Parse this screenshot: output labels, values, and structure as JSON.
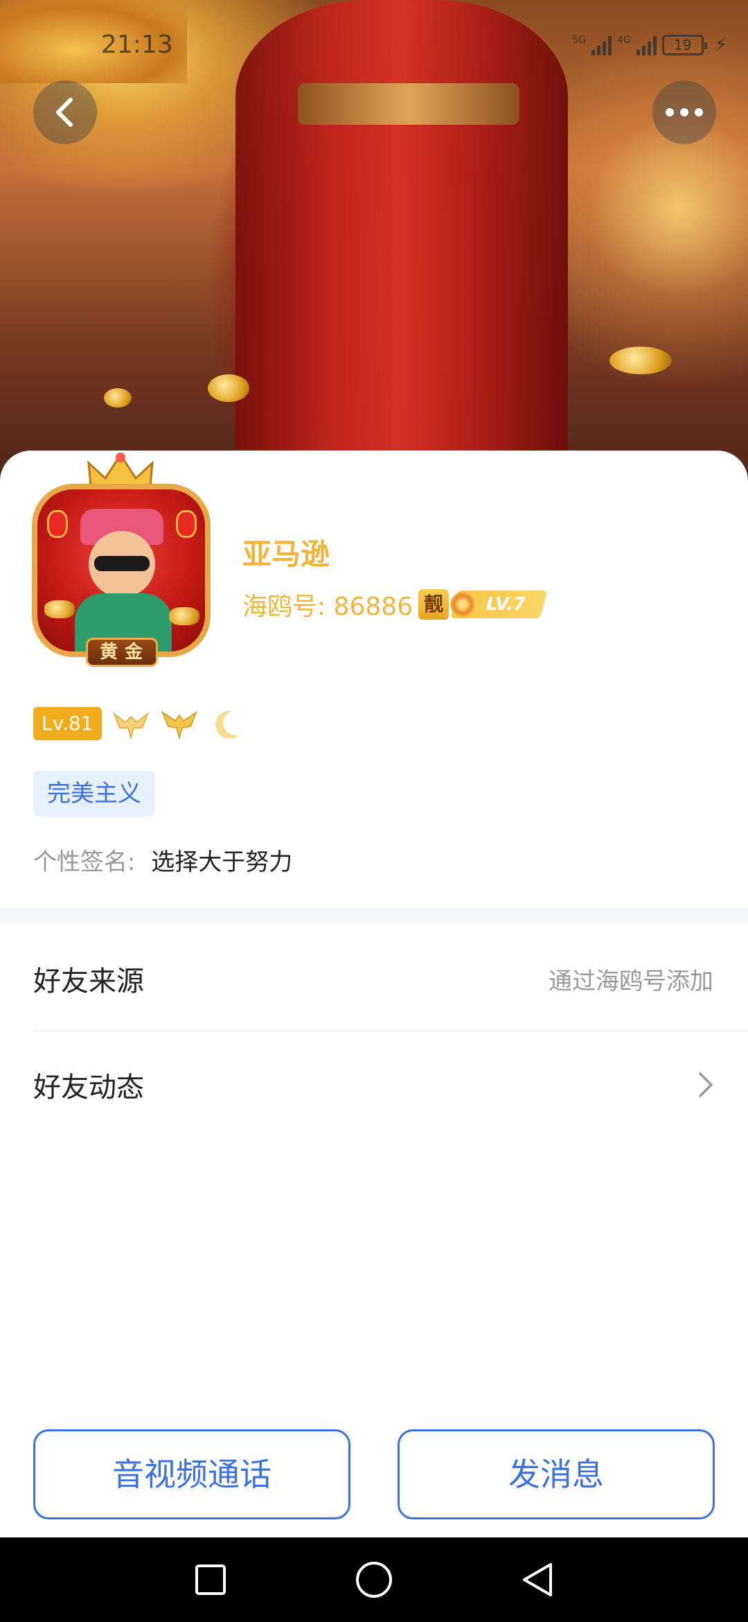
{
  "status_bar": {
    "time": "21:13",
    "net_1": "5G",
    "net_2": "4G",
    "battery": "19"
  },
  "profile": {
    "name": "亚马逊",
    "id_label": "海鸥号: 86886",
    "pretty_tag": "靓",
    "vip_level": "LV.7",
    "avatar_badge": "黄金",
    "user_level": "Lv.81",
    "tag": "完美主义",
    "signature_label": "个性签名:",
    "signature_value": "选择大于努力"
  },
  "rows": {
    "friend_source_title": "好友来源",
    "friend_source_value": "通过海鸥号添加",
    "friend_moments_title": "好友动态"
  },
  "actions": {
    "call_label": "音视频通话",
    "message_label": "发消息"
  },
  "icons": {
    "back": "back-arrow-icon",
    "more": "more-dots-icon",
    "chevron": "chevron-right-icon",
    "nav_recent": "square-icon",
    "nav_home": "circle-icon",
    "nav_back": "triangle-back-icon"
  },
  "colors": {
    "accent_blue": "#3b72e0",
    "gold": "#f0b53a",
    "level_badge": "#f1ac1d"
  }
}
